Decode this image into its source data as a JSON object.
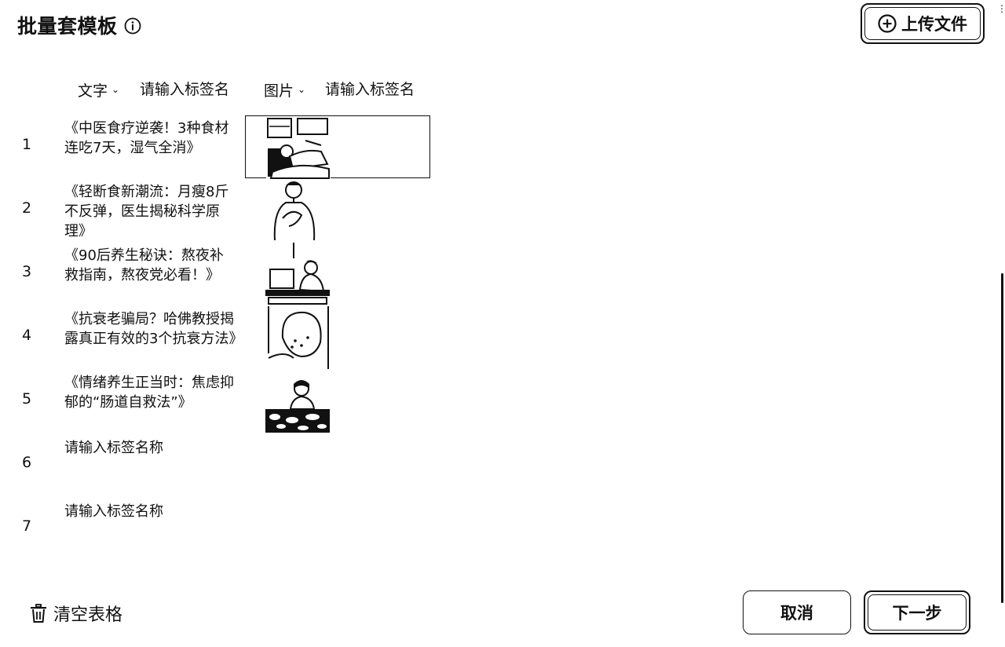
{
  "header": {
    "title": "批量套模板",
    "info_icon": "info-icon",
    "upload_label": "上传文件",
    "upload_icon": "plus-circle-icon"
  },
  "columns": [
    {
      "type_label": "文字",
      "name_placeholder": "请输入标签名"
    },
    {
      "type_label": "图片",
      "name_placeholder": "请输入标签名"
    }
  ],
  "rows": [
    {
      "num": "1",
      "text": "《中医食疗逆袭！3种食材连吃7天，湿气全消》",
      "image": "person-lying-in-bed"
    },
    {
      "num": "2",
      "text": "《轻断食新潮流：月瘦8斤不反弹，医生揭秘科学原理》",
      "image": "person-holding-chest"
    },
    {
      "num": "3",
      "text": "《90后养生秘诀：熬夜补救指南，熬夜党必看！》",
      "image": "person-at-computer"
    },
    {
      "num": "4",
      "text": "《抗衰老骗局？哈佛教授揭露真正有效的3个抗衰方法》",
      "image": "person-face-closeup"
    },
    {
      "num": "5",
      "text": "《情绪养生正当时：焦虑抑郁的“肠道自救法”》",
      "image": "person-with-food"
    },
    {
      "num": "6",
      "text": "",
      "image": ""
    },
    {
      "num": "7",
      "text": "",
      "image": ""
    }
  ],
  "empty_cell_placeholder": "请输入标签名称",
  "footer": {
    "clear_label": "清空表格",
    "clear_icon": "trash-icon",
    "cancel_label": "取消",
    "next_label": "下一步"
  }
}
